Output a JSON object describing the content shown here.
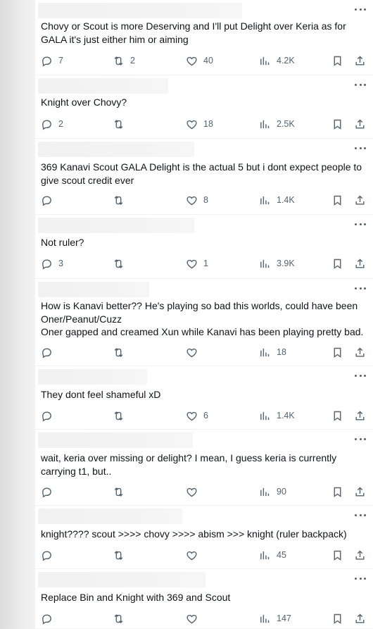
{
  "posts": [
    {
      "text": "Chovy or Scout is more Deserving and I'll put Delight over Keria as for\nGALA it's just either him or aiming",
      "replies": "7",
      "reposts": "2",
      "likes": "40",
      "views": "4.2K"
    },
    {
      "text": "Knight over Chovy?",
      "replies": "2",
      "reposts": "",
      "likes": "18",
      "views": "2.5K"
    },
    {
      "text": "369 Kanavi Scout GALA Delight is the actual 5 but i dont expect people to\ngive scout credit ever",
      "replies": "",
      "reposts": "",
      "likes": "8",
      "views": "1.4K"
    },
    {
      "text": "Not ruler?",
      "replies": "3",
      "reposts": "",
      "likes": "1",
      "views": "3.9K"
    },
    {
      "text": "How is Kanavi better?? He's playing so bad this worlds, could have been\nOner/Peanut/Cuzz\nOner gapped and creamed Xun while Kanavi has been playing pretty bad.",
      "replies": "",
      "reposts": "",
      "likes": "",
      "views": "18"
    },
    {
      "text": "They dont feel shameful xD",
      "replies": "",
      "reposts": "",
      "likes": "6",
      "views": "1.4K"
    },
    {
      "text": "wait, keria over missing or delight? I mean, I guess keria is currently\ncarrying t1, but..",
      "replies": "",
      "reposts": "",
      "likes": "",
      "views": "90"
    },
    {
      "text": "knight???? scout >>>> chovy >>>> abism >>> knight (ruler backpack)",
      "replies": "",
      "reposts": "",
      "likes": "",
      "views": "45"
    },
    {
      "text": "Replace Bin and Knight with 369 and Scout",
      "replies": "",
      "reposts": "",
      "likes": "",
      "views": "147"
    }
  ],
  "icons": {
    "reply": "reply-icon",
    "repost": "repost-icon",
    "like": "heart-icon",
    "views": "views-icon",
    "bookmark": "bookmark-icon",
    "share": "share-icon",
    "more": "more-icon"
  },
  "colors": {
    "icon": "#536471",
    "text": "#0f1419",
    "divider": "#eff3f4"
  }
}
